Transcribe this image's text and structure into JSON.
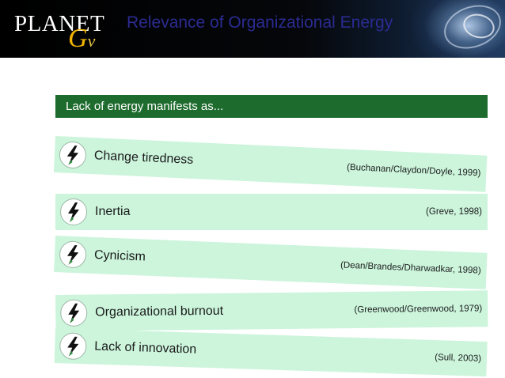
{
  "header": {
    "logo_text": "PLANET",
    "logo_mark": "G",
    "logo_mark_small": "v",
    "title": "Relevance of Organizational Energy"
  },
  "banner": {
    "text": "Lack of energy manifests as..."
  },
  "items": [
    {
      "label": "Change tiredness",
      "citation": "(Buchanan/Claydon/Doyle, 1999)",
      "icon": "lightning-bolt-icon"
    },
    {
      "label": "Inertia",
      "citation": "(Greve, 1998)",
      "icon": "lightning-bolt-icon"
    },
    {
      "label": "Cynicism",
      "citation": "(Dean/Brandes/Dharwadkar, 1998)",
      "icon": "lightning-bolt-icon"
    },
    {
      "label": "Organizational  burnout",
      "citation": "(Greenwood/Greenwood, 1979)",
      "icon": "lightning-bolt-icon"
    },
    {
      "label": "Lack of innovation",
      "citation": "(Sull, 2003)",
      "icon": "lightning-bolt-icon"
    }
  ],
  "colors": {
    "title": "#2b2b92",
    "banner": "#1e6b2e",
    "row": "#ccf5dc",
    "logo_accent": "#f2b400"
  }
}
